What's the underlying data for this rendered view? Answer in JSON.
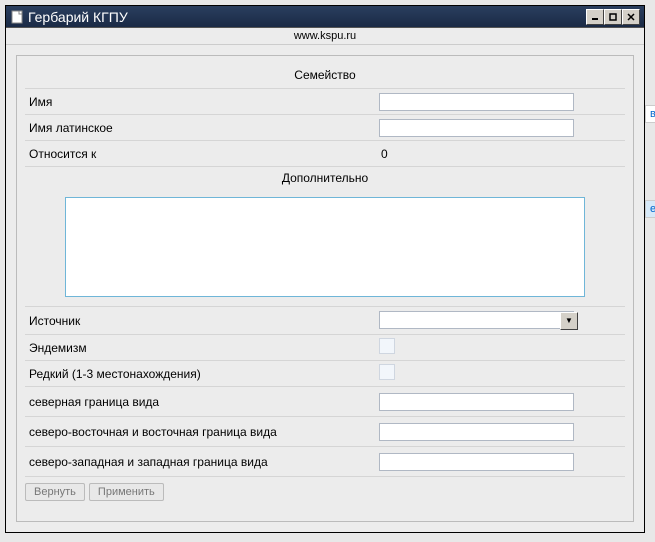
{
  "window": {
    "title": "Гербарий КГПУ",
    "subtitle": "www.kspu.ru"
  },
  "section": {
    "family_header": "Семейство",
    "additional_header": "Дополнительно"
  },
  "form": {
    "name_label": "Имя",
    "name_value": "",
    "latin_label": "Имя латинское",
    "latin_value": "",
    "belongs_label": "Относится к",
    "belongs_value": "0",
    "additional_value": "",
    "source_label": "Источник",
    "source_value": "",
    "endemism_label": "Эндемизм",
    "rare_label": "Редкий (1-3 местонахождения)",
    "north_label": "северная граница вида",
    "north_value": "",
    "northeast_label": "северо-восточная и восточная граница вида",
    "northeast_value": "",
    "northwest_label": "северо-западная и западная граница вида",
    "northwest_value": ""
  },
  "buttons": {
    "revert": "Вернуть",
    "apply": "Применить"
  },
  "bg": {
    "frag1": "ва",
    "frag2": "ен"
  }
}
